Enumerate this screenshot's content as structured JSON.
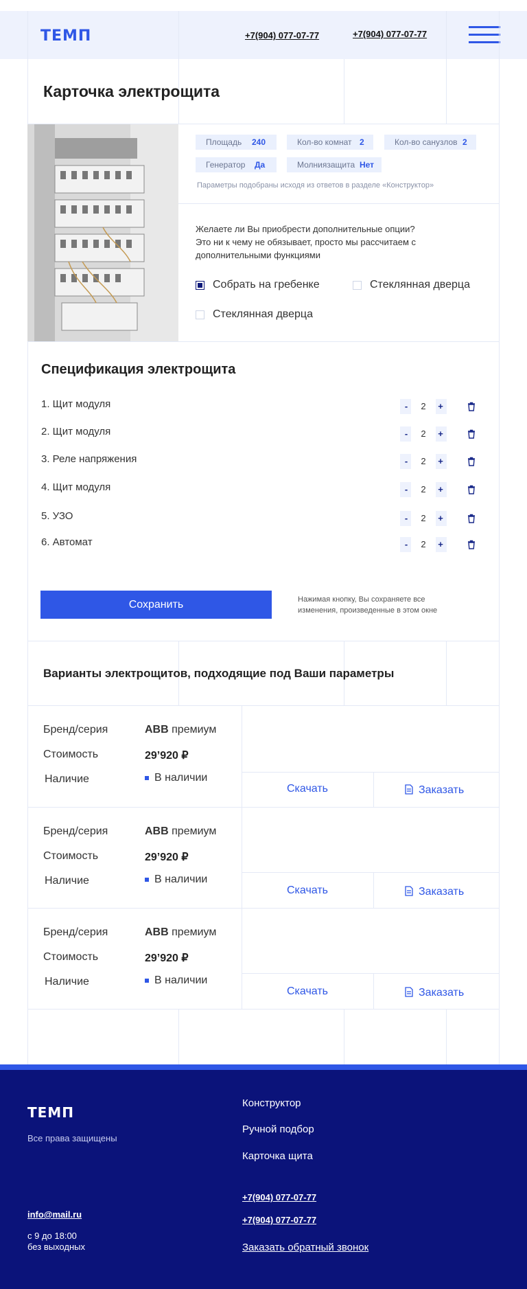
{
  "header": {
    "logo": "ТЕМП",
    "phone_1": "+7(904) 077-07-77",
    "phone_2": "+7(904) 077-07-77",
    "menu_icon": "hamburger-menu-icon"
  },
  "card": {
    "title": "Карточка электрощита",
    "params": [
      {
        "label": "Площадь",
        "value": "240"
      },
      {
        "label": "Кол-во комнат",
        "value": "2"
      },
      {
        "label": "Кол-во санузлов",
        "value": "2"
      },
      {
        "label": "Генератор",
        "value": "Да"
      },
      {
        "label": "Молниязащита",
        "value": "Нет"
      }
    ],
    "hint": "Параметры подобраны исходя из ответов в разделе «Конструктор»",
    "question_line_1": "Желаете ли Вы приобрести  дополнительные опции?",
    "question_line_2": "Это ни к чему не обязывает, просто мы рассчитаем с",
    "question_line_3": "дополнительными функциями",
    "options": [
      {
        "label": "Собрать на гребенке",
        "checked": true
      },
      {
        "label": "Стеклянная дверца",
        "checked": false
      },
      {
        "label": "Стеклянная дверца",
        "checked": false
      }
    ]
  },
  "spec": {
    "title": "Спецификация электрощита",
    "items": [
      {
        "name": "1. Щит модуля",
        "qty": "2"
      },
      {
        "name": "2. Щит модуля",
        "qty": "2"
      },
      {
        "name": "3. Реле напряжения",
        "qty": "2"
      },
      {
        "name": "4. Щит модуля",
        "qty": "2"
      },
      {
        "name": "5. УЗО",
        "qty": "2"
      },
      {
        "name": "6. Автомат",
        "qty": "2"
      }
    ],
    "minus": "-",
    "plus": "+",
    "save_label": "Сохранить",
    "save_note_line_1": "Нажимая кнопку, Вы сохраняете все",
    "save_note_line_2": "изменения, произведенные в этом окне"
  },
  "variants": {
    "title": "Варианты электрощитов, подходящие под Ваши параметры",
    "labels": {
      "brand": "Бренд/серия",
      "price": "Стоимость",
      "stock": "Наличие"
    },
    "download_label": "Скачать",
    "order_label": "Заказать",
    "items": [
      {
        "brand": "ABB",
        "series": "премиум",
        "price": "29’920 ₽",
        "stock": "В наличии"
      },
      {
        "brand": "ABB",
        "series": "премиум",
        "price": "29’920 ₽",
        "stock": "В наличии"
      },
      {
        "brand": "ABB",
        "series": "премиум",
        "price": "29’920 ₽",
        "stock": "В наличии"
      }
    ]
  },
  "footer": {
    "logo": "ТЕМП",
    "rights": "Все права защищены",
    "nav": [
      "Конструктор",
      "Ручной подбор",
      "Карточка щита"
    ],
    "email": "info@mail.ru",
    "hours_line_1": "с 9 до 18:00",
    "hours_line_2": "без выходных",
    "phone_1": "+7(904) 077-07-77",
    "phone_2": "+7(904) 077-07-77",
    "callback": "Заказать обратный звонок"
  },
  "colors": {
    "accent": "#2f57e6",
    "footer_bg": "#0b137a",
    "header_bg": "#eef2fd",
    "chip_bg": "#eaf0fd",
    "grid_line": "#e4e9f6"
  }
}
